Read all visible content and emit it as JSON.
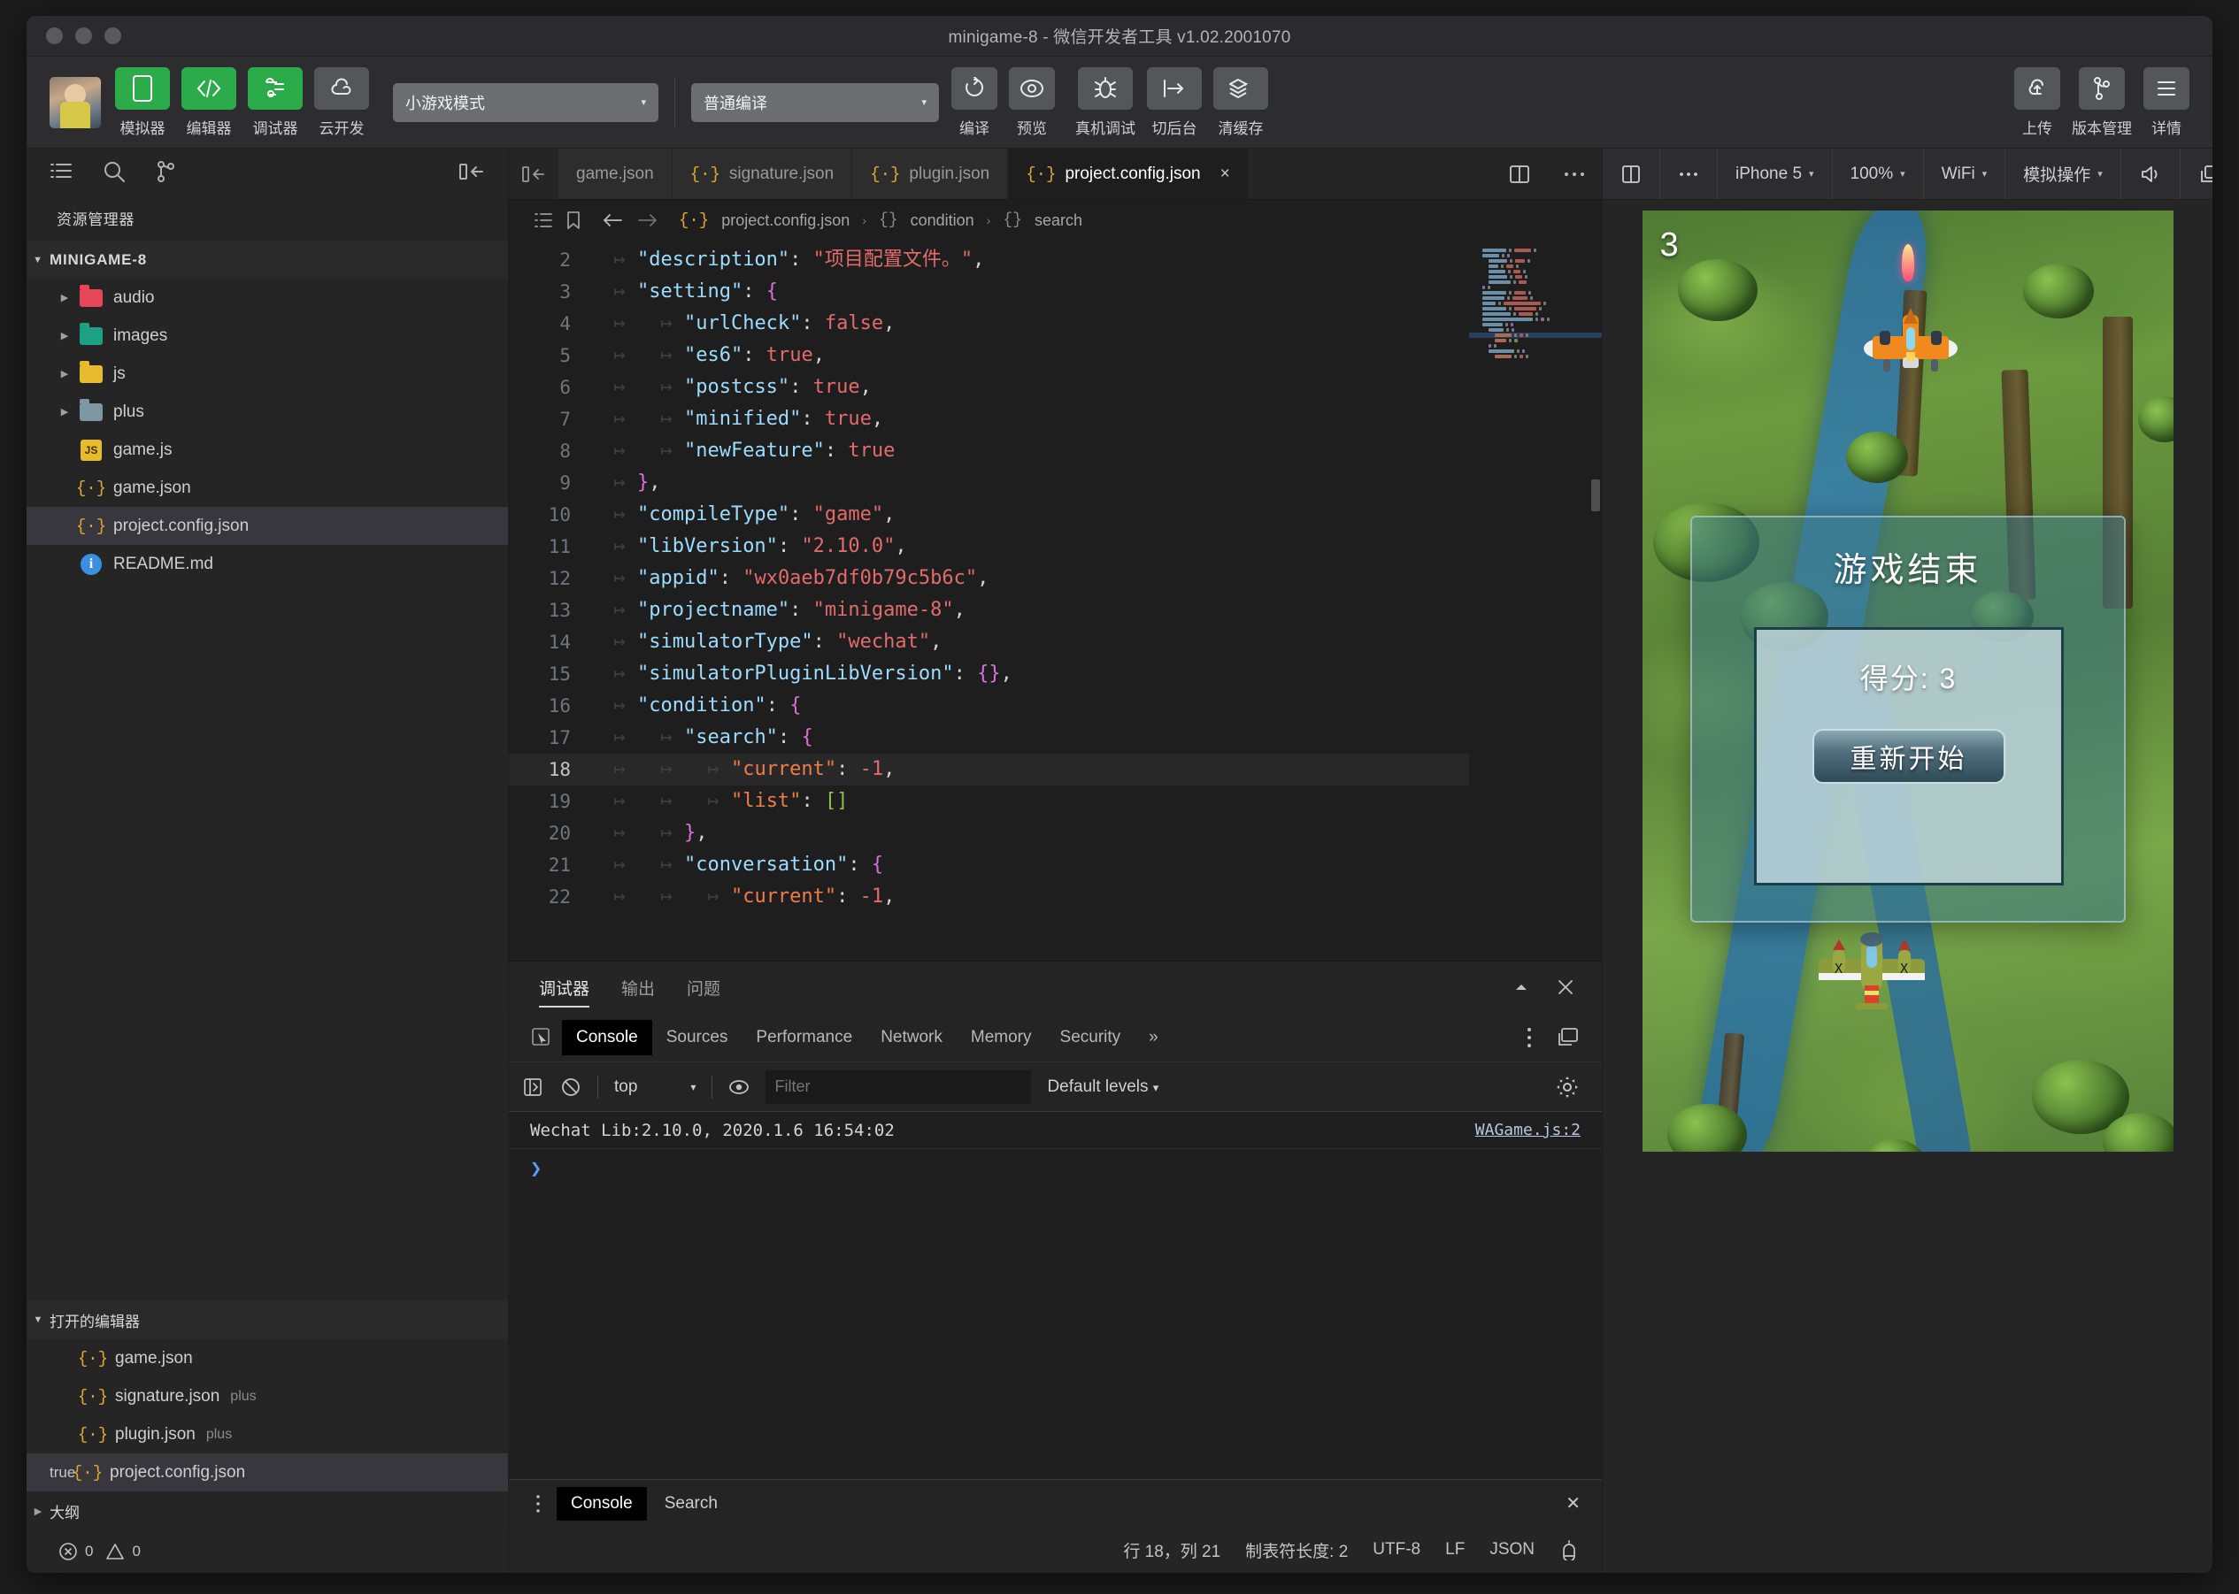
{
  "window": {
    "title": "minigame-8 - 微信开发者工具 v1.02.2001070",
    "traffic_lights": [
      "close",
      "minimize",
      "zoom"
    ]
  },
  "toolbar": {
    "buttons": [
      {
        "label": "模拟器",
        "icon": "phone-icon",
        "style": "green"
      },
      {
        "label": "编辑器",
        "icon": "code-icon",
        "style": "green"
      },
      {
        "label": "调试器",
        "icon": "debug-icon",
        "style": "green"
      },
      {
        "label": "云开发",
        "icon": "cloud-icon",
        "style": "plain"
      }
    ],
    "mode_select": {
      "value": "小游戏模式",
      "caret": "▾"
    },
    "compile_select": {
      "value": "普通编译",
      "caret": "▾"
    },
    "actions": [
      {
        "label": "编译",
        "icon": "refresh-icon"
      },
      {
        "label": "预览",
        "icon": "eye-icon"
      },
      {
        "label": "真机调试",
        "icon": "bug-icon"
      },
      {
        "label": "切后台",
        "icon": "background-icon"
      },
      {
        "label": "清缓存",
        "icon": "layers-icon",
        "caret": "▾"
      }
    ],
    "right_actions": [
      {
        "label": "上传",
        "icon": "upload-icon"
      },
      {
        "label": "版本管理",
        "icon": "branch-icon"
      },
      {
        "label": "详情",
        "icon": "menu-icon"
      }
    ]
  },
  "sidebar": {
    "icons": [
      "list-icon",
      "search-icon",
      "source-control-icon"
    ],
    "collapse_icon": "collapse-sidebar-icon",
    "explorer_title": "资源管理器",
    "project_name": "MINIGAME-8",
    "tree": [
      {
        "label": "audio",
        "type": "folder",
        "color": "#e8455a",
        "expandable": true,
        "indent": 1
      },
      {
        "label": "images",
        "type": "folder",
        "color": "#1ba183",
        "expandable": true,
        "indent": 1
      },
      {
        "label": "js",
        "type": "folder",
        "color": "#e8bb2d",
        "expandable": true,
        "indent": 1
      },
      {
        "label": "plus",
        "type": "folder",
        "color": "#7f96a3",
        "expandable": true,
        "indent": 1
      },
      {
        "label": "game.js",
        "type": "js",
        "expandable": false,
        "indent": 1
      },
      {
        "label": "game.json",
        "type": "json",
        "expandable": false,
        "indent": 1
      },
      {
        "label": "project.config.json",
        "type": "json",
        "expandable": false,
        "indent": 1,
        "selected": true
      },
      {
        "label": "README.md",
        "type": "info",
        "expandable": false,
        "indent": 1
      }
    ],
    "open_editors": {
      "title": "打开的编辑器",
      "items": [
        {
          "label": "game.json",
          "suffix": "",
          "type": "json"
        },
        {
          "label": "signature.json",
          "suffix": "plus",
          "type": "json"
        },
        {
          "label": "plugin.json",
          "suffix": "plus",
          "type": "json"
        },
        {
          "label": "project.config.json",
          "suffix": "",
          "type": "json",
          "selected": true,
          "closable": true
        }
      ]
    },
    "outline_title": "大纲",
    "problems": {
      "errors": "0",
      "warnings": "0"
    }
  },
  "editor": {
    "tabs": [
      {
        "label": "game.json",
        "icon": "json-icon",
        "active": false,
        "truncated": true
      },
      {
        "label": "signature.json",
        "icon": "json-icon",
        "active": false
      },
      {
        "label": "plugin.json",
        "icon": "json-icon",
        "active": false
      },
      {
        "label": "project.config.json",
        "icon": "json-icon",
        "active": true,
        "close": "×"
      }
    ],
    "tab_actions": [
      "split-editor-icon",
      "more-actions-icon"
    ],
    "breadcrumb": {
      "icons": [
        "outline-icon",
        "bookmark-icon",
        "back-arrow-icon",
        "forward-arrow-icon"
      ],
      "path": [
        {
          "icon": "json-icon",
          "label": "project.config.json"
        },
        {
          "icon": "object-icon",
          "label": "condition"
        },
        {
          "icon": "object-icon",
          "label": "search"
        }
      ],
      "separator": "›"
    },
    "lines": [
      {
        "n": "2",
        "indent": 1,
        "tokens": [
          [
            "key",
            "\"description\""
          ],
          [
            "pun",
            ": "
          ],
          [
            "str",
            "\"项目配置文件。\""
          ],
          [
            "pun",
            ","
          ]
        ]
      },
      {
        "n": "3",
        "indent": 1,
        "tokens": [
          [
            "key",
            "\"setting\""
          ],
          [
            "pun",
            ": "
          ],
          [
            "brace",
            "{"
          ]
        ]
      },
      {
        "n": "4",
        "indent": 2,
        "tokens": [
          [
            "key",
            "\"urlCheck\""
          ],
          [
            "pun",
            ": "
          ],
          [
            "bool",
            "false"
          ],
          [
            "pun",
            ","
          ]
        ]
      },
      {
        "n": "5",
        "indent": 2,
        "tokens": [
          [
            "key",
            "\"es6\""
          ],
          [
            "pun",
            ": "
          ],
          [
            "bool",
            "true"
          ],
          [
            "pun",
            ","
          ]
        ]
      },
      {
        "n": "6",
        "indent": 2,
        "tokens": [
          [
            "key",
            "\"postcss\""
          ],
          [
            "pun",
            ": "
          ],
          [
            "bool",
            "true"
          ],
          [
            "pun",
            ","
          ]
        ]
      },
      {
        "n": "7",
        "indent": 2,
        "tokens": [
          [
            "key",
            "\"minified\""
          ],
          [
            "pun",
            ": "
          ],
          [
            "bool",
            "true"
          ],
          [
            "pun",
            ","
          ]
        ]
      },
      {
        "n": "8",
        "indent": 2,
        "tokens": [
          [
            "key",
            "\"newFeature\""
          ],
          [
            "pun",
            ": "
          ],
          [
            "bool",
            "true"
          ]
        ]
      },
      {
        "n": "9",
        "indent": 1,
        "tokens": [
          [
            "brace",
            "}"
          ],
          [
            "pun",
            ","
          ]
        ]
      },
      {
        "n": "10",
        "indent": 1,
        "tokens": [
          [
            "key",
            "\"compileType\""
          ],
          [
            "pun",
            ": "
          ],
          [
            "str",
            "\"game\""
          ],
          [
            "pun",
            ","
          ]
        ]
      },
      {
        "n": "11",
        "indent": 1,
        "tokens": [
          [
            "key",
            "\"libVersion\""
          ],
          [
            "pun",
            ": "
          ],
          [
            "str",
            "\"2.10.0\""
          ],
          [
            "pun",
            ","
          ]
        ]
      },
      {
        "n": "12",
        "indent": 1,
        "tokens": [
          [
            "key",
            "\"appid\""
          ],
          [
            "pun",
            ": "
          ],
          [
            "str",
            "\"wx0aeb7df0b79c5b6c\""
          ],
          [
            "pun",
            ","
          ]
        ]
      },
      {
        "n": "13",
        "indent": 1,
        "tokens": [
          [
            "key",
            "\"projectname\""
          ],
          [
            "pun",
            ": "
          ],
          [
            "str",
            "\"minigame-8\""
          ],
          [
            "pun",
            ","
          ]
        ]
      },
      {
        "n": "14",
        "indent": 1,
        "tokens": [
          [
            "key",
            "\"simulatorType\""
          ],
          [
            "pun",
            ": "
          ],
          [
            "str",
            "\"wechat\""
          ],
          [
            "pun",
            ","
          ]
        ]
      },
      {
        "n": "15",
        "indent": 1,
        "tokens": [
          [
            "key",
            "\"simulatorPluginLibVersion\""
          ],
          [
            "pun",
            ": "
          ],
          [
            "brace",
            "{}"
          ],
          [
            "pun",
            ","
          ]
        ]
      },
      {
        "n": "16",
        "indent": 1,
        "tokens": [
          [
            "key",
            "\"condition\""
          ],
          [
            "pun",
            ": "
          ],
          [
            "brace",
            "{"
          ]
        ]
      },
      {
        "n": "17",
        "indent": 2,
        "tokens": [
          [
            "key",
            "\"search\""
          ],
          [
            "pun",
            ": "
          ],
          [
            "brace",
            "{"
          ]
        ]
      },
      {
        "n": "18",
        "indent": 3,
        "highlight": true,
        "tokens": [
          [
            "key2",
            "\"current\""
          ],
          [
            "pun",
            ": "
          ],
          [
            "num",
            "-1"
          ],
          [
            "pun",
            ","
          ]
        ]
      },
      {
        "n": "19",
        "indent": 3,
        "tokens": [
          [
            "key2",
            "\"list\""
          ],
          [
            "pun",
            ": "
          ],
          [
            "brack",
            "[]"
          ]
        ]
      },
      {
        "n": "20",
        "indent": 2,
        "tokens": [
          [
            "brace",
            "}"
          ],
          [
            "pun",
            ","
          ]
        ]
      },
      {
        "n": "21",
        "indent": 2,
        "tokens": [
          [
            "key",
            "\"conversation\""
          ],
          [
            "pun",
            ": "
          ],
          [
            "brace",
            "{"
          ]
        ]
      },
      {
        "n": "22",
        "indent": 3,
        "tokens": [
          [
            "key2",
            "\"current\""
          ],
          [
            "pun",
            ": "
          ],
          [
            "num",
            "-1"
          ],
          [
            "pun",
            ","
          ]
        ]
      }
    ]
  },
  "devtools": {
    "panel_tabs": [
      {
        "label": "调试器",
        "active": true
      },
      {
        "label": "输出",
        "active": false
      },
      {
        "label": "问题",
        "active": false
      }
    ],
    "panel_actions": [
      "collapse-icon",
      "close-icon"
    ],
    "inspect_icon": "inspect-element-icon",
    "tabs": [
      {
        "label": "Console",
        "active": true
      },
      {
        "label": "Sources",
        "active": false
      },
      {
        "label": "Performance",
        "active": false
      },
      {
        "label": "Network",
        "active": false
      },
      {
        "label": "Memory",
        "active": false
      },
      {
        "label": "Security",
        "active": false
      }
    ],
    "more_tabs": "»",
    "right_icons": [
      "kebab-menu-icon",
      "dock-side-icon"
    ],
    "filter_bar": {
      "execute_icon": "execution-context-icon",
      "clear_icon": "clear-console-icon",
      "context": "top",
      "context_caret": "▾",
      "eye_icon": "live-expression-icon",
      "filter_placeholder": "Filter",
      "filter_value": "",
      "levels": "Default levels",
      "levels_caret": "▾",
      "settings_icon": "gear-icon"
    },
    "messages": [
      {
        "text": "Wechat Lib:2.10.0, 2020.1.6 16:54:02",
        "source": "WAGame.js:2"
      }
    ],
    "prompt": "❯",
    "drawer": {
      "kebab_icon": "drawer-menu-icon",
      "tabs": [
        {
          "label": "Console",
          "active": true
        },
        {
          "label": "Search",
          "active": false
        }
      ],
      "close": "✕"
    }
  },
  "statusbar": {
    "items": [
      "行 18，列 21",
      "制表符长度: 2",
      "UTF-8",
      "LF",
      "JSON"
    ],
    "bell_icon": "notification-bell-icon"
  },
  "simulator": {
    "toolbar": [
      {
        "label": "",
        "icon": "split-panel-icon"
      },
      {
        "label": "",
        "icon": "more-icon"
      },
      {
        "label": "iPhone 5",
        "caret": "▾"
      },
      {
        "label": "100%",
        "caret": "▾"
      },
      {
        "label": "WiFi",
        "caret": "▾"
      },
      {
        "label": "模拟操作",
        "caret": "▾"
      },
      {
        "label": "",
        "icon": "volume-icon"
      },
      {
        "label": "",
        "icon": "detach-icon"
      }
    ],
    "game": {
      "score_hud": "3",
      "dialog_title": "游戏结束",
      "dialog_score": "得分: 3",
      "restart_button": "重新开始"
    }
  },
  "colors": {
    "accent_green": "#2cab4b",
    "json_icon": "#e0a62e",
    "selection": "#37373d",
    "link": "#b8c8e0"
  }
}
